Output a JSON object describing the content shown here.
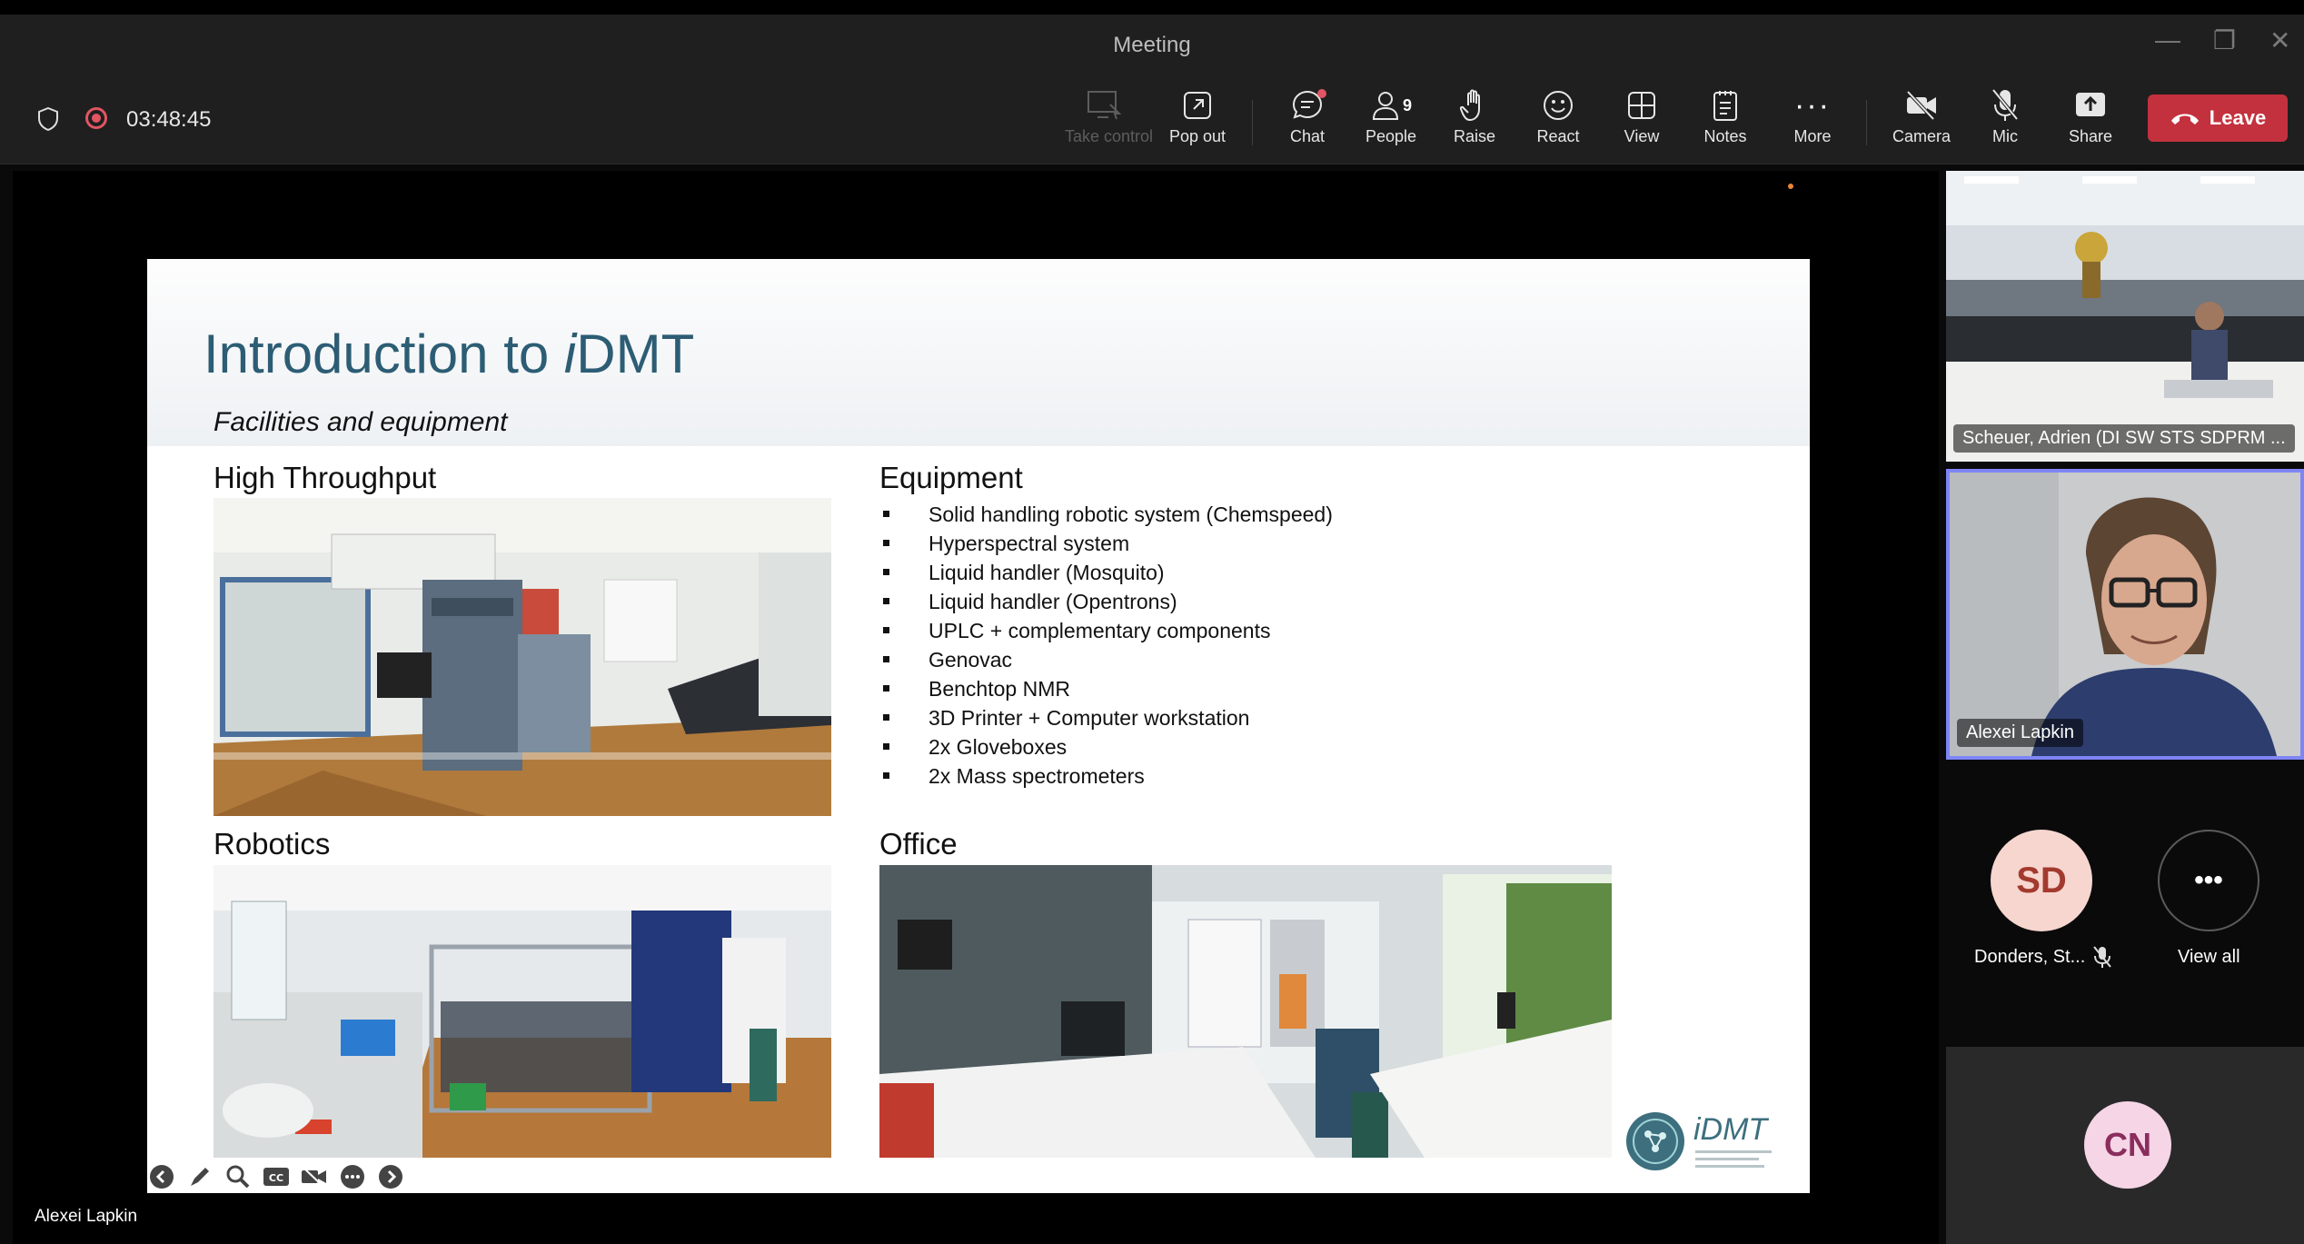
{
  "window": {
    "title": "Meeting"
  },
  "toolbar": {
    "timer": "03:48:45",
    "buttons": {
      "take_control": "Take control",
      "pop_out": "Pop out",
      "chat": "Chat",
      "people": "People",
      "people_count": "9",
      "raise": "Raise",
      "react": "React",
      "view": "View",
      "notes": "Notes",
      "more": "More",
      "camera": "Camera",
      "mic": "Mic",
      "share": "Share"
    },
    "leave_label": "Leave",
    "leave_color": "#c4313e"
  },
  "slide": {
    "title_prefix": "Introduction to ",
    "title_italic": "i",
    "title_suffix": "DMT",
    "subtitle": "Facilities and equipment",
    "sections": {
      "high_throughput": "High Throughput",
      "equipment": "Equipment",
      "robotics": "Robotics",
      "office": "Office"
    },
    "equipment_items": [
      "Solid handling robotic system (Chemspeed)",
      "Hyperspectral system",
      "Liquid handler (Mosquito)",
      "Liquid handler (Opentrons)",
      "UPLC + complementary components",
      "Genovac",
      "Benchtop NMR",
      "3D Printer + Computer workstation",
      "2x Gloveboxes",
      "2x Mass spectrometers"
    ],
    "logo_text": "iDMT",
    "title_color": "#2c5d74"
  },
  "stage": {
    "presenter_name": "Alexei Lapkin"
  },
  "participants": {
    "room_tile_name": "Scheuer, Adrien (DI SW STS SDPRM ...",
    "speaker_tile_name": "Alexei Lapkin",
    "sd_initials": "SD",
    "sd_name": "Donders, St...",
    "view_all": "View all",
    "cn_initials": "CN"
  }
}
